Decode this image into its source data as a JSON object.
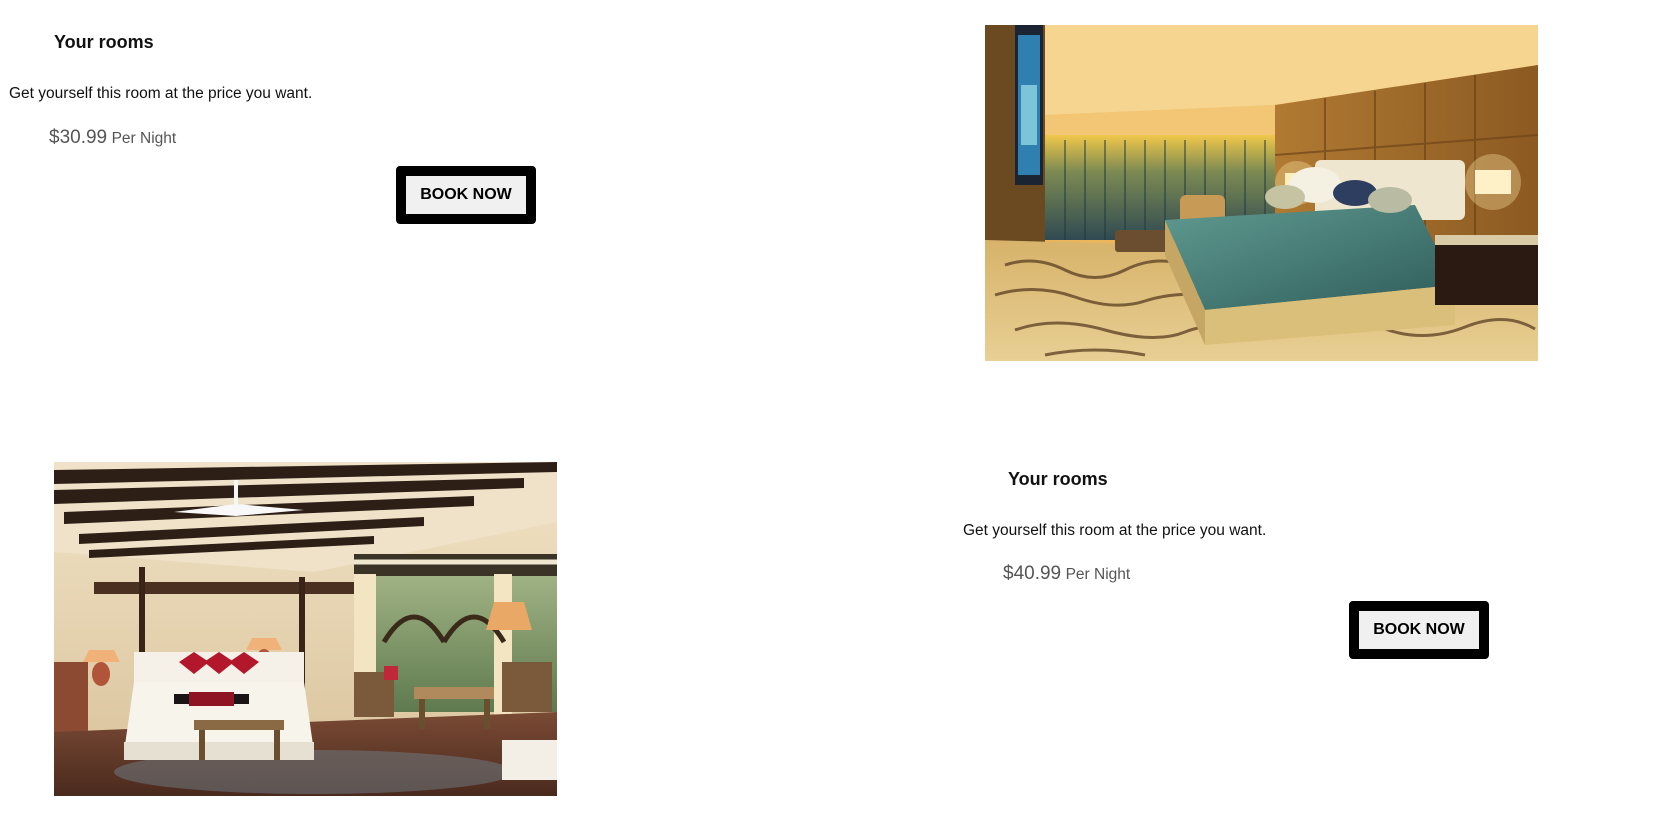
{
  "rooms": [
    {
      "title": "Your rooms",
      "description": "Get yourself this room at the price you want.",
      "price": "$30.99",
      "price_unit": "Per Night",
      "button_label": "BOOK NOW"
    },
    {
      "title": "Your rooms",
      "description": "Get yourself this room at the price you want.",
      "price": "$40.99",
      "price_unit": "Per Night",
      "button_label": "BOOK NOW"
    }
  ],
  "colors": {
    "text": "#111111",
    "price": "#555555",
    "button_border": "#000000",
    "button_fill": "#f0f0f0"
  }
}
